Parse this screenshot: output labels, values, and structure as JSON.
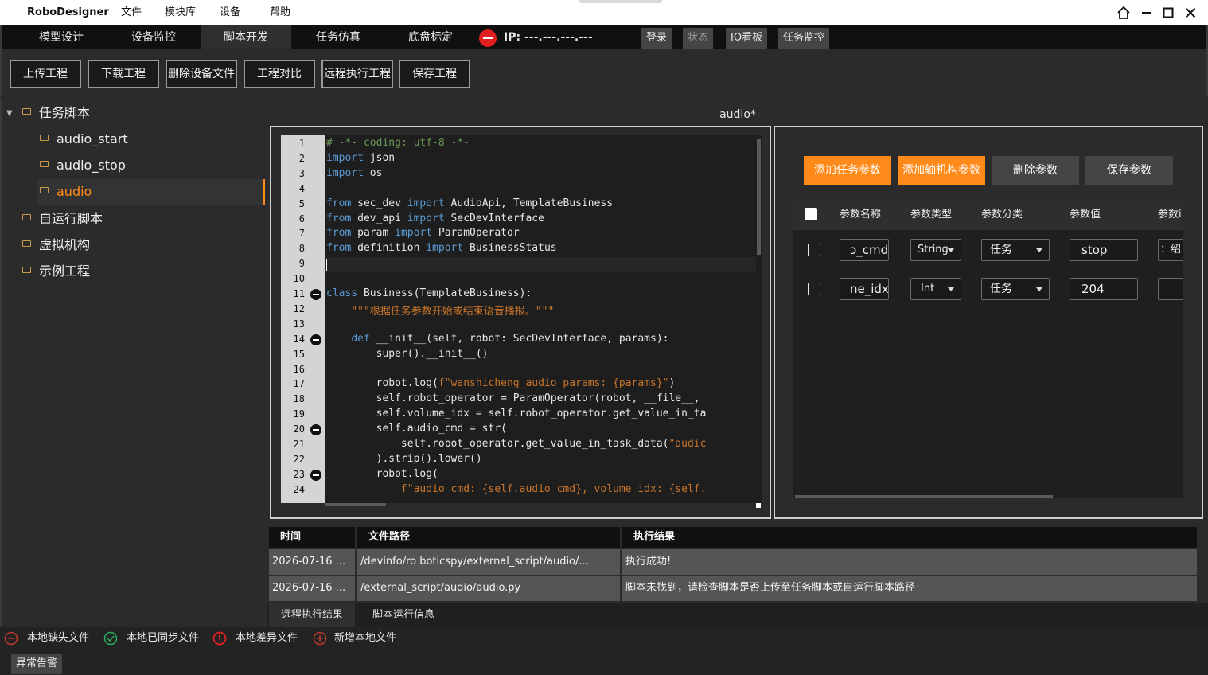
{
  "window": {
    "app_title": "RoboDesigner",
    "menu": [
      "文件",
      "模块库",
      "设备",
      "帮助"
    ]
  },
  "nav": {
    "tabs": [
      "模型设计",
      "设备监控",
      "脚本开发",
      "任务仿真",
      "底盘标定"
    ],
    "active_tab": "脚本开发",
    "ip_label": "IP: ---.---.---.---",
    "buttons": [
      "登录",
      "状态",
      "IO看板",
      "任务监控"
    ]
  },
  "toolbar": {
    "buttons": [
      "上传工程",
      "下载工程",
      "删除设备文件",
      "工程对比",
      "远程执行工程",
      "保存工程"
    ]
  },
  "tree": {
    "root": "任务脚本",
    "children": [
      "audio_start",
      "audio_stop",
      "audio"
    ],
    "selected": "audio",
    "others": [
      "自运行脚本",
      "虚拟机构",
      "示例工程"
    ]
  },
  "editor": {
    "title": "audio*",
    "line_numbers": [
      "1",
      "2",
      "3",
      "4",
      "5",
      "6",
      "7",
      "8",
      "9",
      "10",
      "11",
      "12",
      "13",
      "14",
      "15",
      "16",
      "17",
      "18",
      "19",
      "20",
      "21",
      "22",
      "23",
      "24"
    ],
    "lines": [
      "# -*- coding: utf-8 -*-",
      "import json",
      "import os",
      "",
      "from sec_dev import AudioApi, TemplateBusiness",
      "from dev_api import SecDevInterface",
      "from param import ParamOperator",
      "from definition import BusinessStatus",
      "",
      "",
      "class Business(TemplateBusiness):",
      "    \"\"\"根据任务参数开始或结束语音播报。\"\"\"",
      "",
      "    def __init__(self, robot: SecDevInterface, params):",
      "        super().__init__()",
      "",
      "        robot.log(f\"wanshicheng_audio params: {params}\")",
      "        self.robot_operator = ParamOperator(robot, __file__,",
      "        self.volume_idx = self.robot_operator.get_value_in_ta",
      "        self.audio_cmd = str(",
      "            self.robot_operator.get_value_in_task_data(\"audic",
      "        ).strip().lower()",
      "        robot.log(",
      "            f\"audio_cmd: {self.audio_cmd}, volume_idx: {self."
    ]
  },
  "params": {
    "buttons": [
      "添加任务参数",
      "添加轴机构参数",
      "删除参数",
      "保存参数"
    ],
    "columns": [
      "参数名称",
      "参数类型",
      "参数分类",
      "参数值",
      "参数i"
    ],
    "rows": [
      {
        "name": "ɔ_cmd",
        "type": "String",
        "category": "任务",
        "value": "stop",
        "extra": "：绍"
      },
      {
        "name": "ne_idx",
        "type": "Int",
        "category": "任务",
        "value": "204",
        "extra": ""
      }
    ]
  },
  "results": {
    "columns": [
      "时间",
      "文件路径",
      "执行结果"
    ],
    "rows": [
      {
        "time": "2026-07-16 ...",
        "path": "/devinfo/ro boticspy/external_script/audio/...",
        "result": "执行成功!"
      },
      {
        "time": "2026-07-16 ...",
        "path": "/external_script/audio/audio.py",
        "result": "脚本未找到，请检查脚本是否上传至任务脚本或自运行脚本路径"
      }
    ],
    "tabs": [
      "远程执行结果",
      "脚本运行信息"
    ]
  },
  "legend": [
    {
      "label": "本地缺失文件",
      "icon": "minus-circle-icon",
      "color": "#c0392b"
    },
    {
      "label": "本地已同步文件",
      "icon": "check-circle-icon",
      "color": "#27ae60"
    },
    {
      "label": "本地差异文件",
      "icon": "alert-circle-icon",
      "color": "#e02020"
    },
    {
      "label": "新增本地文件",
      "icon": "plus-circle-icon",
      "color": "#c0392b"
    }
  ],
  "status": {
    "alarm_label": "异常告警"
  },
  "colors": {
    "accent": "#ff8a1a",
    "keyword": "#5b9bd5",
    "string": "#c8742a",
    "comment": "#6a9955"
  }
}
